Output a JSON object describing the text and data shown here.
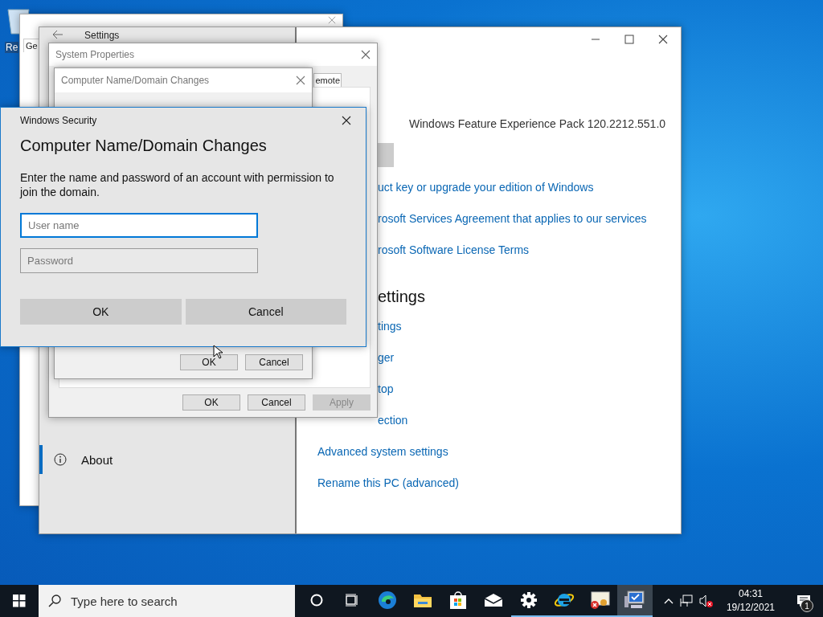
{
  "desktop_icons": [
    {
      "label": "Re",
      "selected": true
    }
  ],
  "certificate_window": {
    "tab": "Ge"
  },
  "settings_window": {
    "title": "Settings",
    "nav": [
      {
        "label": "About",
        "selected": true
      }
    ],
    "items": [
      {
        "kind": "value",
        "text": "Windows Feature Experience Pack 120.2212.551.0"
      },
      {
        "kind": "cut-link",
        "text": "uct key or upgrade your edition of Windows"
      },
      {
        "kind": "cut-link",
        "text": "rosoft Services Agreement that applies to our services"
      },
      {
        "kind": "cut-link",
        "text": "rosoft Software License Terms"
      },
      {
        "kind": "cut-heading",
        "text": "ettings"
      },
      {
        "kind": "cut-link",
        "text": "tings"
      },
      {
        "kind": "cut-link",
        "text": "ger"
      },
      {
        "kind": "cut-link",
        "text": "top"
      },
      {
        "kind": "cut-link",
        "text": "ection"
      },
      {
        "kind": "link",
        "text": "Advanced system settings"
      },
      {
        "kind": "link",
        "text": "Rename this PC (advanced)"
      }
    ]
  },
  "system_properties": {
    "title": "System Properties",
    "tab": "emote",
    "buttons": [
      {
        "label": "OK",
        "disabled": false
      },
      {
        "label": "Cancel",
        "disabled": false
      },
      {
        "label": "Apply",
        "disabled": true
      }
    ]
  },
  "name_changes_dialog": {
    "title": "Computer Name/Domain Changes",
    "buttons": [
      "OK",
      "Cancel"
    ]
  },
  "security_dialog": {
    "title": "Windows Security",
    "heading": "Computer Name/Domain Changes",
    "message": "Enter the name and password of an account with permission to join the domain.",
    "fields": [
      {
        "placeholder": "User name",
        "focused": true
      },
      {
        "placeholder": "Password",
        "focused": false
      }
    ],
    "buttons": [
      "OK",
      "Cancel"
    ]
  },
  "taskbar": {
    "search": {
      "placeholder": "Type here to search"
    },
    "apps": [
      {
        "kind": "cortana",
        "running": false,
        "selected": false
      },
      {
        "kind": "taskview",
        "running": false,
        "selected": false
      },
      {
        "kind": "edge",
        "running": false,
        "selected": false
      },
      {
        "kind": "explorer",
        "running": false,
        "selected": false
      },
      {
        "kind": "store",
        "running": false,
        "selected": false
      },
      {
        "kind": "mail",
        "running": false,
        "selected": false
      },
      {
        "kind": "settings",
        "running": true,
        "selected": false
      },
      {
        "kind": "ie",
        "running": true,
        "selected": false
      },
      {
        "kind": "certificate",
        "running": true,
        "selected": false
      },
      {
        "kind": "system",
        "running": true,
        "selected": true
      }
    ],
    "clock": {
      "time": "04:31",
      "date": "19/12/2021"
    },
    "notification_count": "1"
  }
}
